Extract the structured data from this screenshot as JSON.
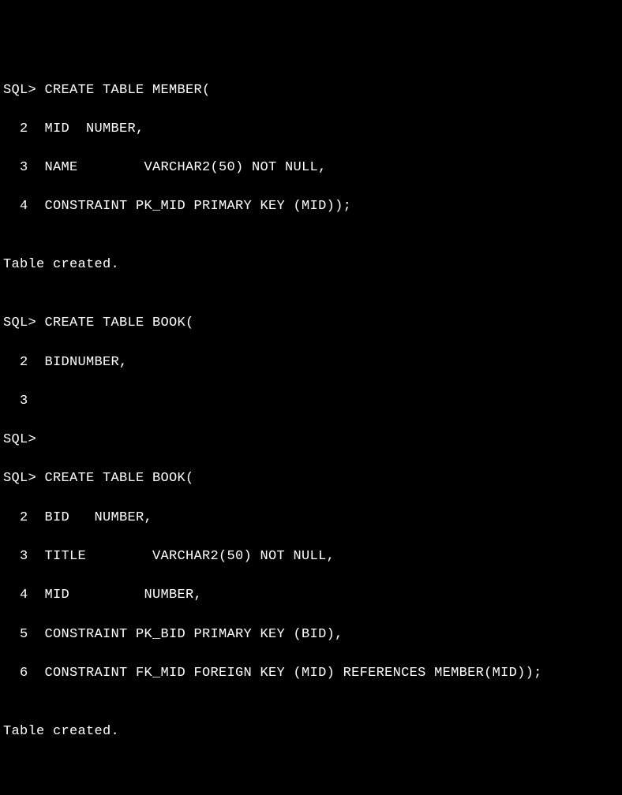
{
  "terminal": {
    "lines": [
      "SQL> CREATE TABLE MEMBER(",
      "  2  MID  NUMBER,",
      "  3  NAME        VARCHAR2(50) NOT NULL,",
      "  4  CONSTRAINT PK_MID PRIMARY KEY (MID));",
      "",
      "Table created.",
      "",
      "SQL> CREATE TABLE BOOK(",
      "  2  BIDNUMBER,",
      "  3",
      "SQL>",
      "SQL> CREATE TABLE BOOK(",
      "  2  BID   NUMBER,",
      "  3  TITLE        VARCHAR2(50) NOT NULL,",
      "  4  MID         NUMBER,",
      "  5  CONSTRAINT PK_BID PRIMARY KEY (BID),",
      "  6  CONSTRAINT FK_MID FOREIGN KEY (MID) REFERENCES MEMBER(MID));",
      "",
      "Table created."
    ]
  }
}
